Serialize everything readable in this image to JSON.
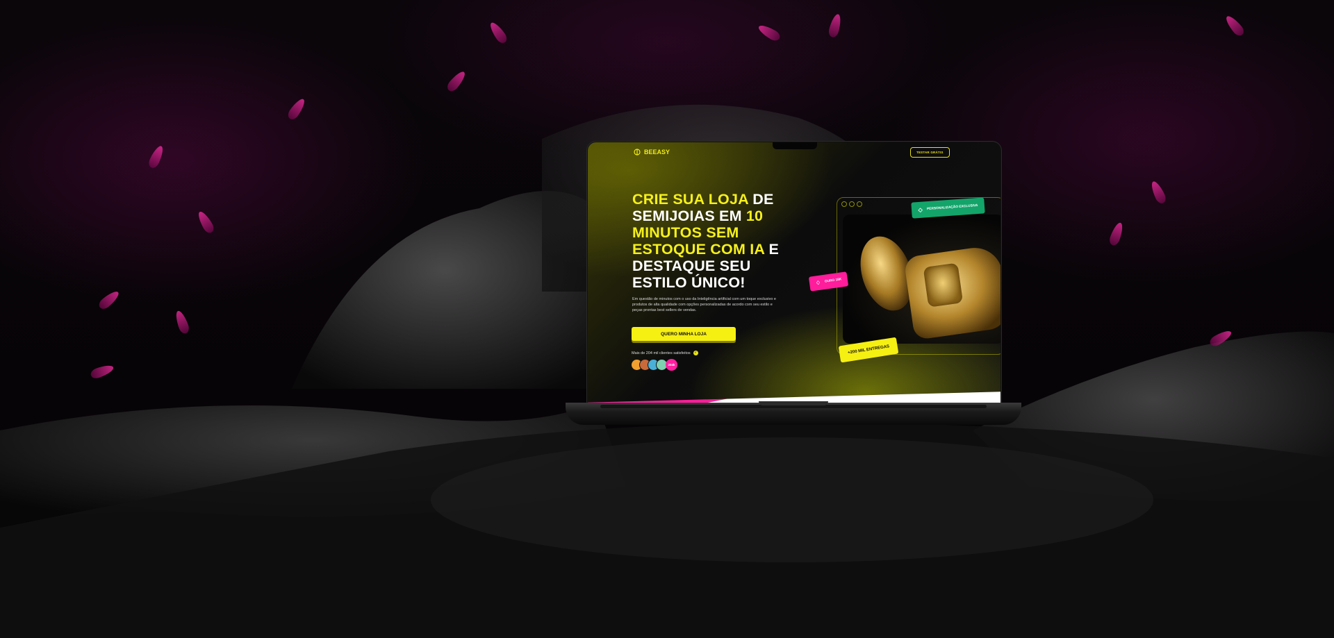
{
  "brand": {
    "name": "BEEASY",
    "icon": "bee-logo-icon"
  },
  "header": {
    "try_label": "TESTAR GRÁTIS"
  },
  "hero": {
    "h_part1": "Crie sua loja",
    "h_part2": " de semijoias em ",
    "h_part3": "10 minutos sem estoque com IA",
    "h_part4": " e destaque seu estilo único!",
    "description": "Em questão de minutos com o uso da Inteligência artificial com um toque exclusivo e produtos de alta qualidade com opções personalizadas de acordo com seu estilo e peças prontas best sellers de vendas.",
    "cta_label": "QUERO MINHA LOJA",
    "clients_text": "Mais de 204 mil clientes satisfeitos",
    "avatar_count": "204k"
  },
  "badges": {
    "green": "PERSONALIZAÇÃO EXCLUSIVA",
    "pink": "OURO 18K",
    "yellow": "+200 MIL ENTREGAS"
  },
  "colors": {
    "accent_yellow": "#f6ef12",
    "accent_pink": "#ff1d9c",
    "accent_green": "#13a46a"
  }
}
